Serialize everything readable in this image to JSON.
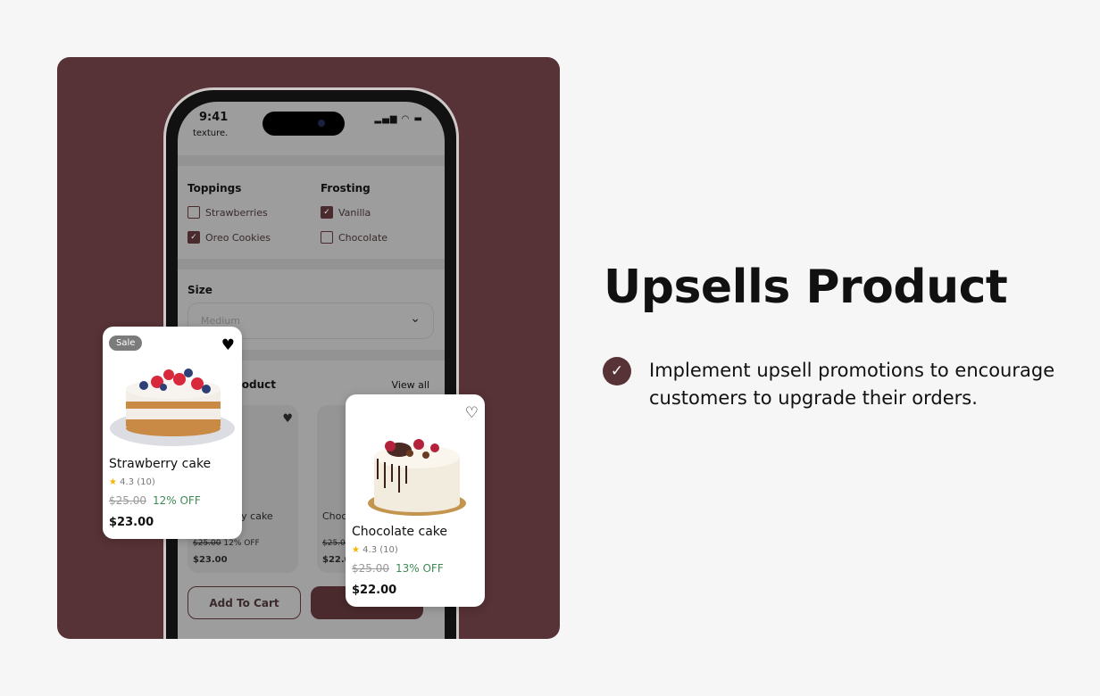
{
  "panel_color": "#573236",
  "phone": {
    "time": "9:41",
    "status_icons": [
      "signal-icon",
      "wifi-icon",
      "battery-icon"
    ],
    "texture_text": "texture.",
    "toppings": {
      "title": "Toppings",
      "options": [
        {
          "label": "Strawberries",
          "checked": false
        },
        {
          "label": "Oreo Cookies",
          "checked": true
        }
      ]
    },
    "frosting": {
      "title": "Frosting",
      "options": [
        {
          "label": "Vanilla",
          "checked": true
        },
        {
          "label": "Chocolate",
          "checked": false
        }
      ]
    },
    "size": {
      "title": "Size",
      "value": "Medium"
    },
    "upsell": {
      "title": "Upsell Product",
      "view_all": "View all"
    },
    "bg_cards": [
      {
        "name": "Strawberry cake",
        "old": "$25.00",
        "off": "12% OFF",
        "price": "$23.00"
      },
      {
        "name": "Chocolate cake",
        "old": "$25.00",
        "price": "$22.00"
      }
    ],
    "add_to_cart": "Add To Cart"
  },
  "cards": [
    {
      "badge": "Sale",
      "name": "Strawberry cake",
      "rating": "4.3 (10)",
      "old_price": "$25.00",
      "discount": "12% OFF",
      "price": "$23.00",
      "favorited": true
    },
    {
      "name": "Chocolate cake",
      "rating": "4.3 (10)",
      "old_price": "$25.00",
      "discount": "13% OFF",
      "price": "$22.00",
      "favorited": false
    }
  ],
  "heading": "Upsells Product",
  "bullet": "Implement upsell promotions to encourage customers to upgrade their orders.",
  "colors": {
    "accent": "#573236",
    "discount": "#3f8a55",
    "star": "#f5b400"
  }
}
